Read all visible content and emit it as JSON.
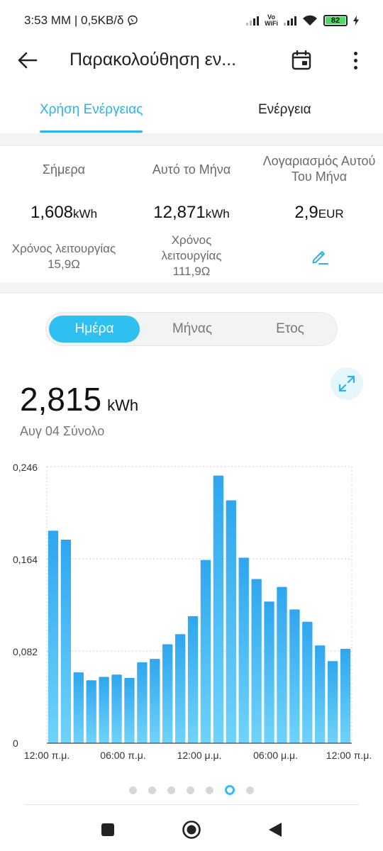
{
  "status_bar": {
    "time_net": "3:53 MM | 0,5KB/δ",
    "vowifi_top": "Vo",
    "vowifi_bottom": "WiFi",
    "battery_level": "82"
  },
  "header": {
    "title": "Παρακολούθηση εν..."
  },
  "tabs": [
    {
      "label": "Χρήση Ενέργειας",
      "active": true
    },
    {
      "label": "Ενέργεια",
      "active": false
    }
  ],
  "summary": {
    "today": {
      "label": "Σήμερα",
      "value": "1,608",
      "unit": "kWh",
      "runtime": "Χρόνος λειτουργίας 15,9Ω"
    },
    "month": {
      "label": "Αυτό το Μήνα",
      "value": "12,871",
      "unit": "kWh",
      "runtime": "Χρόνος λειτουργίας 111,9Ω"
    },
    "bill": {
      "label": "Λογαριασμός Αυτού Του Μήνα",
      "value": "2,9",
      "unit": "EUR"
    }
  },
  "period_selector": {
    "options": [
      "Ημέρα",
      "Μήνας",
      "Ετος"
    ],
    "selected": "Ημέρα"
  },
  "total": {
    "value": "2,815",
    "unit": "kWh",
    "caption": "Αυγ 04 Σύνολο"
  },
  "chart_data": {
    "type": "bar",
    "bar_color_top": "#2ea6ef",
    "bar_color_bottom": "#6fd3fb",
    "ylim": [
      0,
      0.246
    ],
    "y_ticks": [
      "0",
      "0,082",
      "0,164",
      "0,246"
    ],
    "x_tick_labels": [
      "12:00 π.μ.",
      "06:00 π.μ.",
      "12:00 μ.μ.",
      "06:00 μ.μ.",
      "12:00 π.μ."
    ],
    "grid": true,
    "values": [
      0.189,
      0.181,
      0.063,
      0.056,
      0.059,
      0.061,
      0.058,
      0.072,
      0.075,
      0.088,
      0.097,
      0.113,
      0.163,
      0.238,
      0.216,
      0.165,
      0.146,
      0.126,
      0.139,
      0.119,
      0.108,
      0.087,
      0.073,
      0.084
    ]
  },
  "pager": {
    "count": 7,
    "active_index": 5
  },
  "colors": {
    "accent": "#2db3e6",
    "segment_active": "#2ec0f0"
  }
}
